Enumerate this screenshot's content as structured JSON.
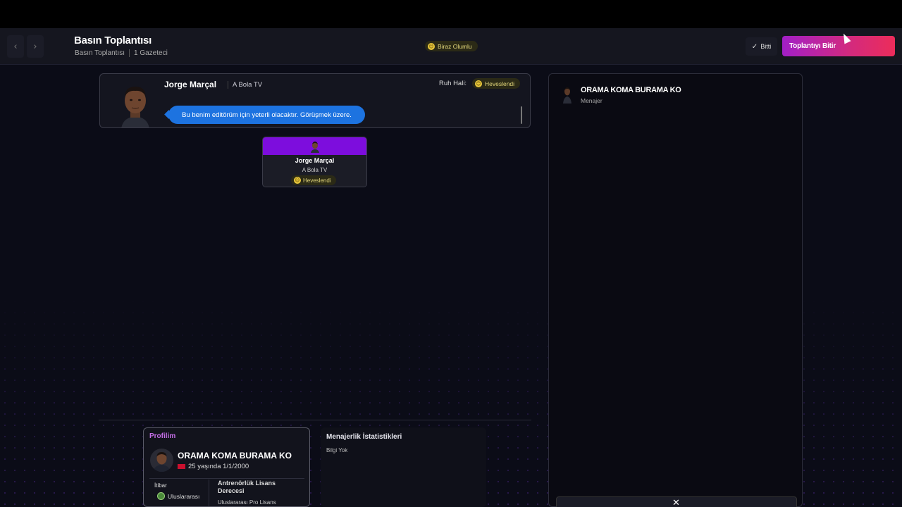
{
  "header": {
    "title": "Basın Toplantısı",
    "breadcrumb": "Basın Toplantısı",
    "count": "1 Gazeteci",
    "overall_mood": "Biraz Olumlu",
    "done_label": "Bitti",
    "end_button_label": "Toplantıyı Bitir"
  },
  "speaker": {
    "name": "Jorge Marçal",
    "outlet": "A Bola TV",
    "mood_label": "Ruh Hali:",
    "mood": "Heveslendi",
    "message": "Bu benim editörüm için yeterli olacaktır. Görüşmek üzere."
  },
  "node": {
    "name": "Jorge Marçal",
    "outlet": "A Bola TV",
    "mood": "Heveslendi"
  },
  "profile": {
    "label": "Profilim",
    "name": "ORAMA KOMA BURAMA KO",
    "age_dob": "25 yaşında 1/1/2000",
    "reputation_label": "İtibar",
    "reputation_value": "Uluslararası",
    "license_label": "Antrenörlük Lisans Derecesi",
    "license_value": "Uluslararası Pro Lisans"
  },
  "stats": {
    "title": "Menajerlik İstatistikleri",
    "empty": "Bilgi Yok"
  },
  "right_panel": {
    "name": "ORAMA KOMA BURAMA KO",
    "role": "Menajer"
  },
  "icons": {
    "back": "chevron-left-icon",
    "forward": "chevron-right-icon",
    "check": "check-icon",
    "close": "close-icon",
    "mood": "smile-icon"
  },
  "colors": {
    "accent_start": "#a21fc7",
    "accent_end": "#ec2c5a",
    "speech_bubble": "#1d73e0",
    "node_header": "#7d0ddd",
    "mood_text": "#e2d67a"
  }
}
